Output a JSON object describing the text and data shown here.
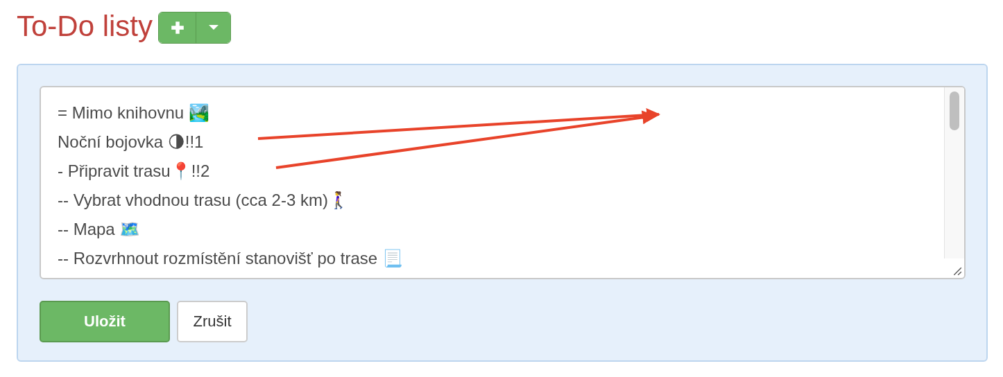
{
  "title": "To-Do listy",
  "editor": {
    "lines": [
      "= Mimo knihovnu 🏞️",
      "Noční bojovka 🌗!!1",
      "- Připravit trasu📍!!2",
      "-- Vybrat vhodnou trasu (cca 2-3 km)🚶‍♀️",
      "-- Mapa 🗺️",
      "-- Rozvrhnout rozmístění stanovišť po trase 📃"
    ]
  },
  "buttons": [
    {
      "label": "Uložit",
      "kind": "primary"
    },
    {
      "label": "Zrušit",
      "kind": "default"
    }
  ]
}
